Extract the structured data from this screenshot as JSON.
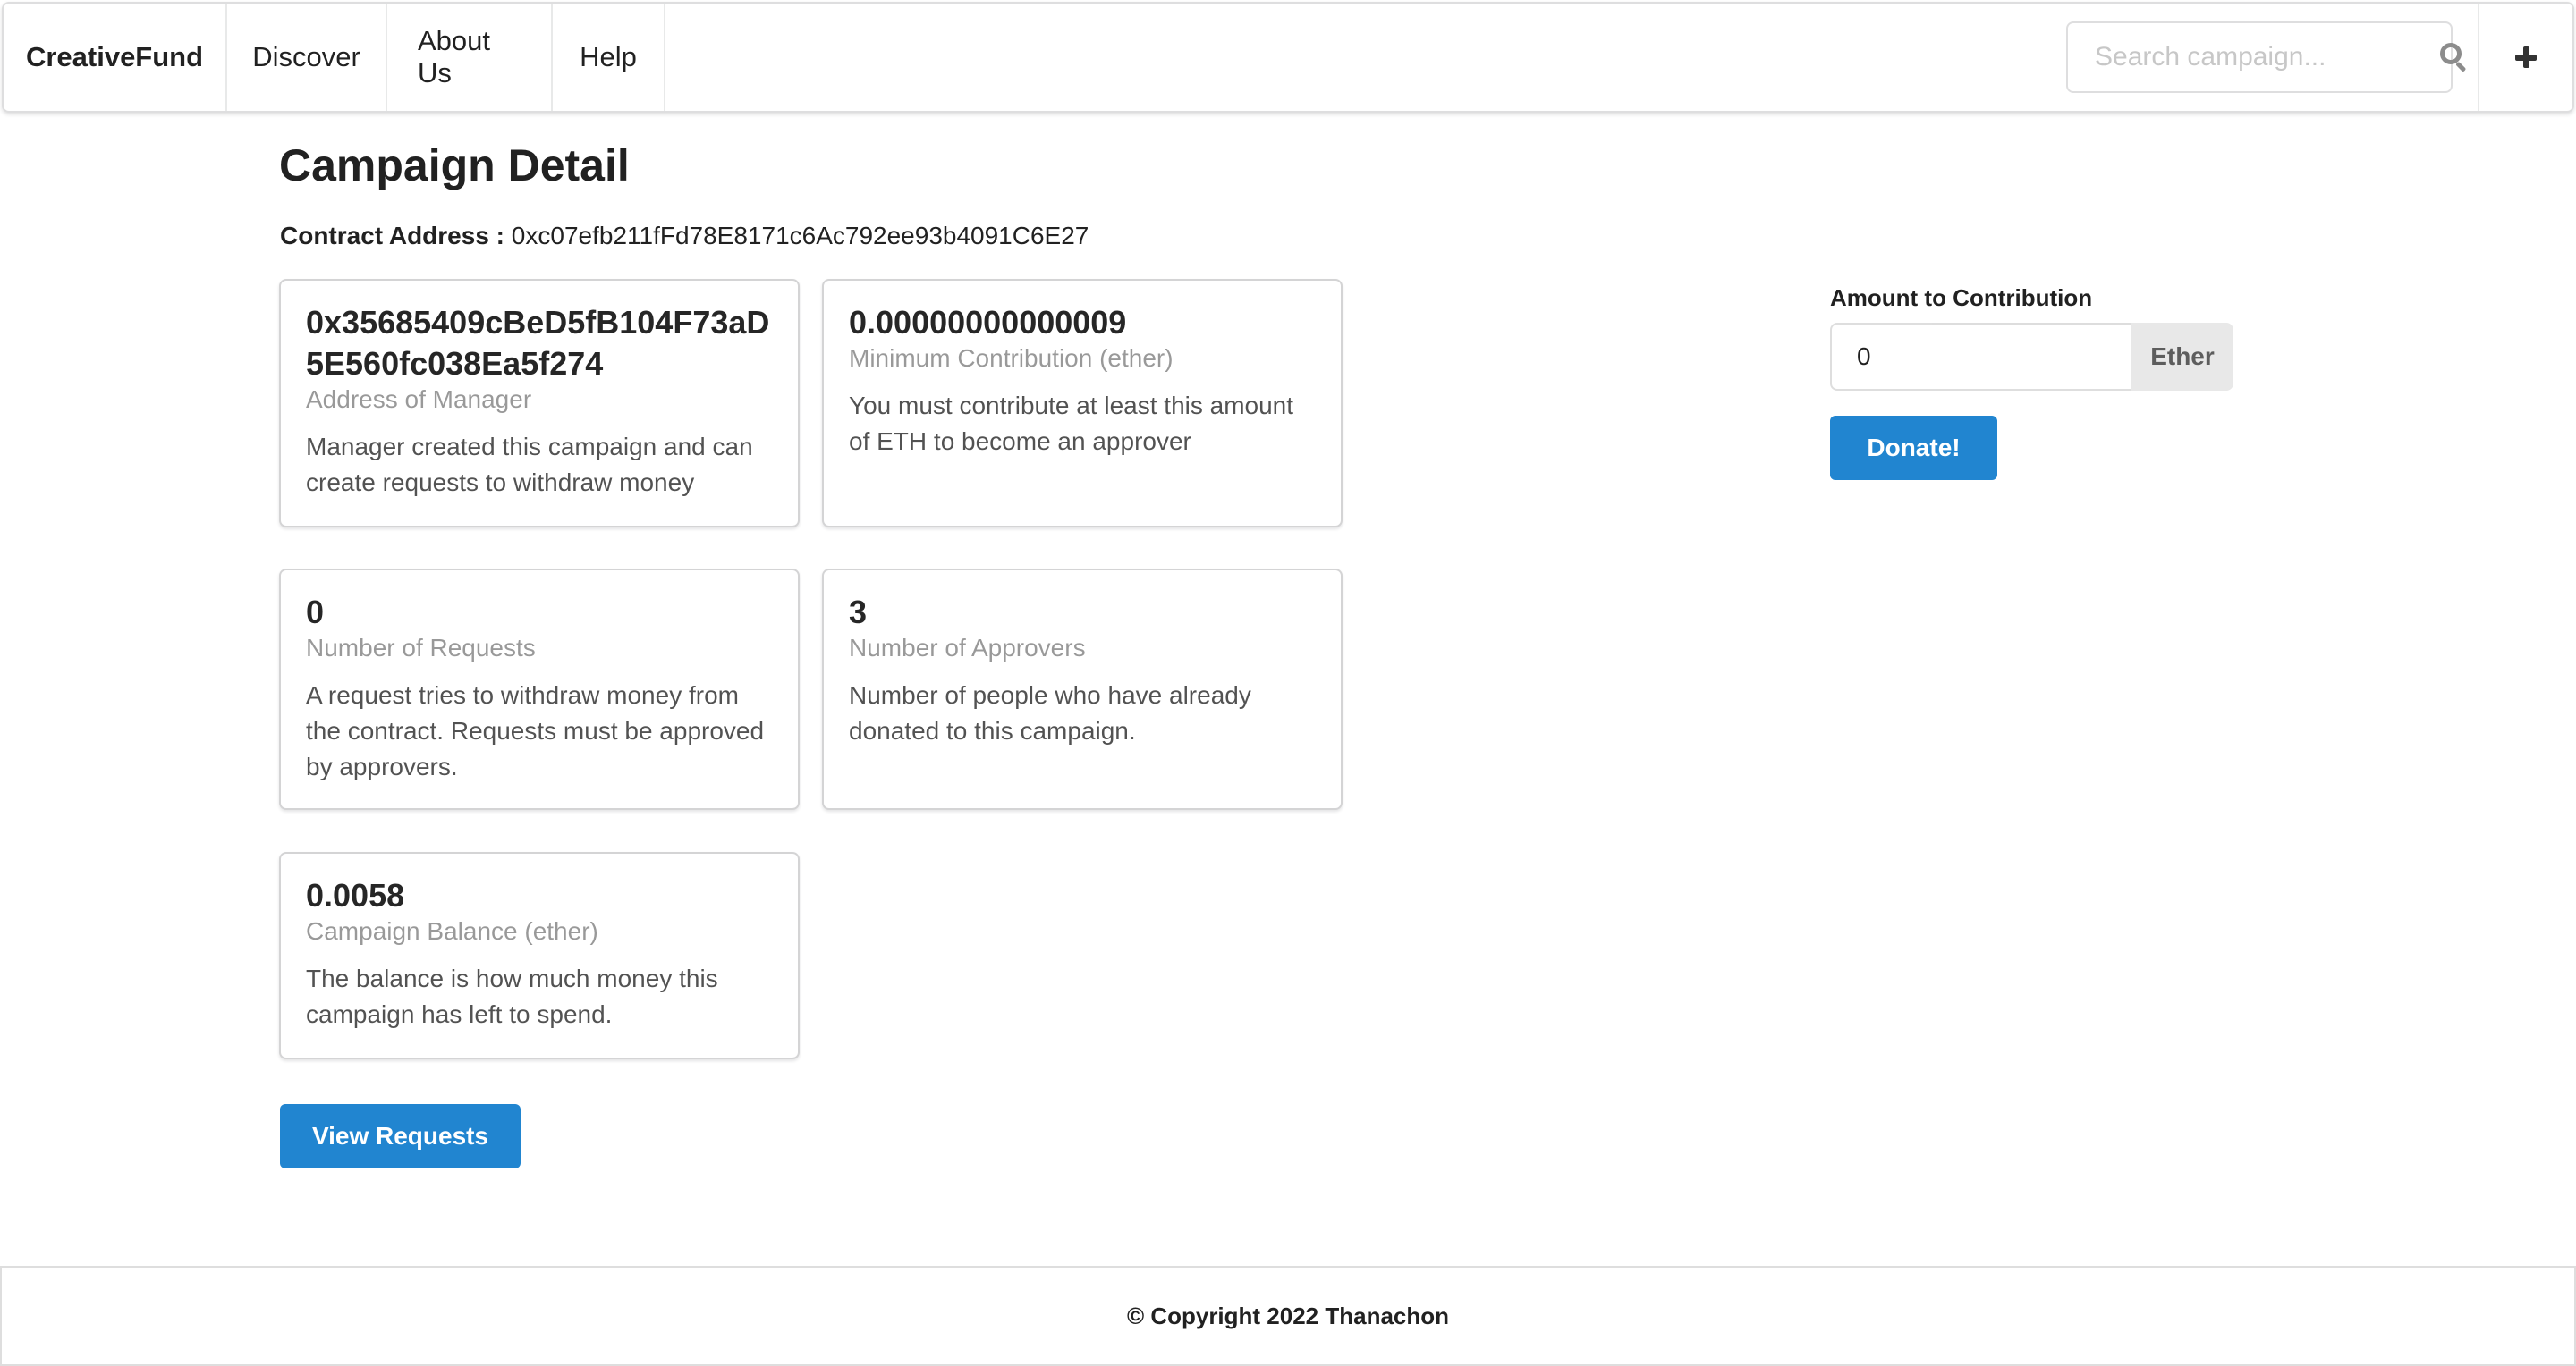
{
  "navbar": {
    "brand": "CreativeFund",
    "items": [
      {
        "label": "Discover"
      },
      {
        "label": "About Us"
      },
      {
        "label": "Help"
      }
    ],
    "search": {
      "placeholder": "Search campaign...",
      "value": "",
      "icon": "search-icon"
    },
    "add_icon": "plus-icon"
  },
  "page": {
    "title": "Campaign Detail",
    "contract_label": "Contract Address :",
    "contract_address": "0xc07efb211fFd78E8171c6Ac792ee93b4091C6E27"
  },
  "cards": {
    "manager": {
      "header": "0x35685409cBeD5fB104F73aD5E560fc038Ea5f274",
      "meta": "Address of Manager",
      "description": "Manager created this campaign and can create requests to withdraw money"
    },
    "minimum_contribution": {
      "header": "0.00000000000009",
      "meta": "Minimum Contribution (ether)",
      "description": "You must contribute at least this amount of ETH to become an approver"
    },
    "requests": {
      "header": "0",
      "meta": "Number of Requests",
      "description": "A request tries to withdraw money from the contract. Requests must be approved by approvers."
    },
    "approvers": {
      "header": "3",
      "meta": "Number of Approvers",
      "description": "Number of people who have already donated to this campaign."
    },
    "balance": {
      "header": "0.0058",
      "meta": "Campaign Balance (ether)",
      "description": "The balance is how much money this campaign has left to spend."
    }
  },
  "actions": {
    "view_requests_label": "View Requests"
  },
  "contribution": {
    "label": "Amount to Contribution",
    "value": "0",
    "unit": "Ether",
    "donate_label": "Donate!"
  },
  "colors": {
    "primary": "#2185d0",
    "unit_bg": "#e8e8e8"
  },
  "footer": {
    "text": "© Copyright 2022 Thanachon"
  }
}
